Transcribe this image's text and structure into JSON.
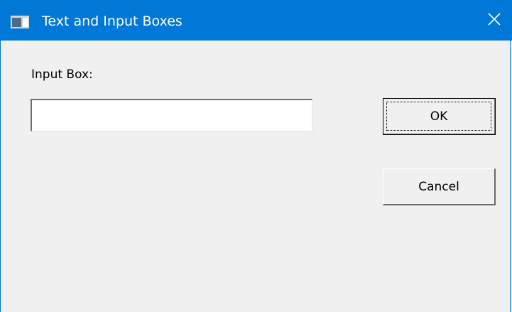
{
  "window": {
    "title": "Text and Input Boxes",
    "app_icon": "window-app-icon",
    "close_icon": "close-icon"
  },
  "form": {
    "label": "Input Box:",
    "input_value": "",
    "input_placeholder": ""
  },
  "buttons": {
    "ok_label": "OK",
    "cancel_label": "Cancel"
  },
  "colors": {
    "titlebar": "#0078d7",
    "background": "#f0f0f0"
  }
}
